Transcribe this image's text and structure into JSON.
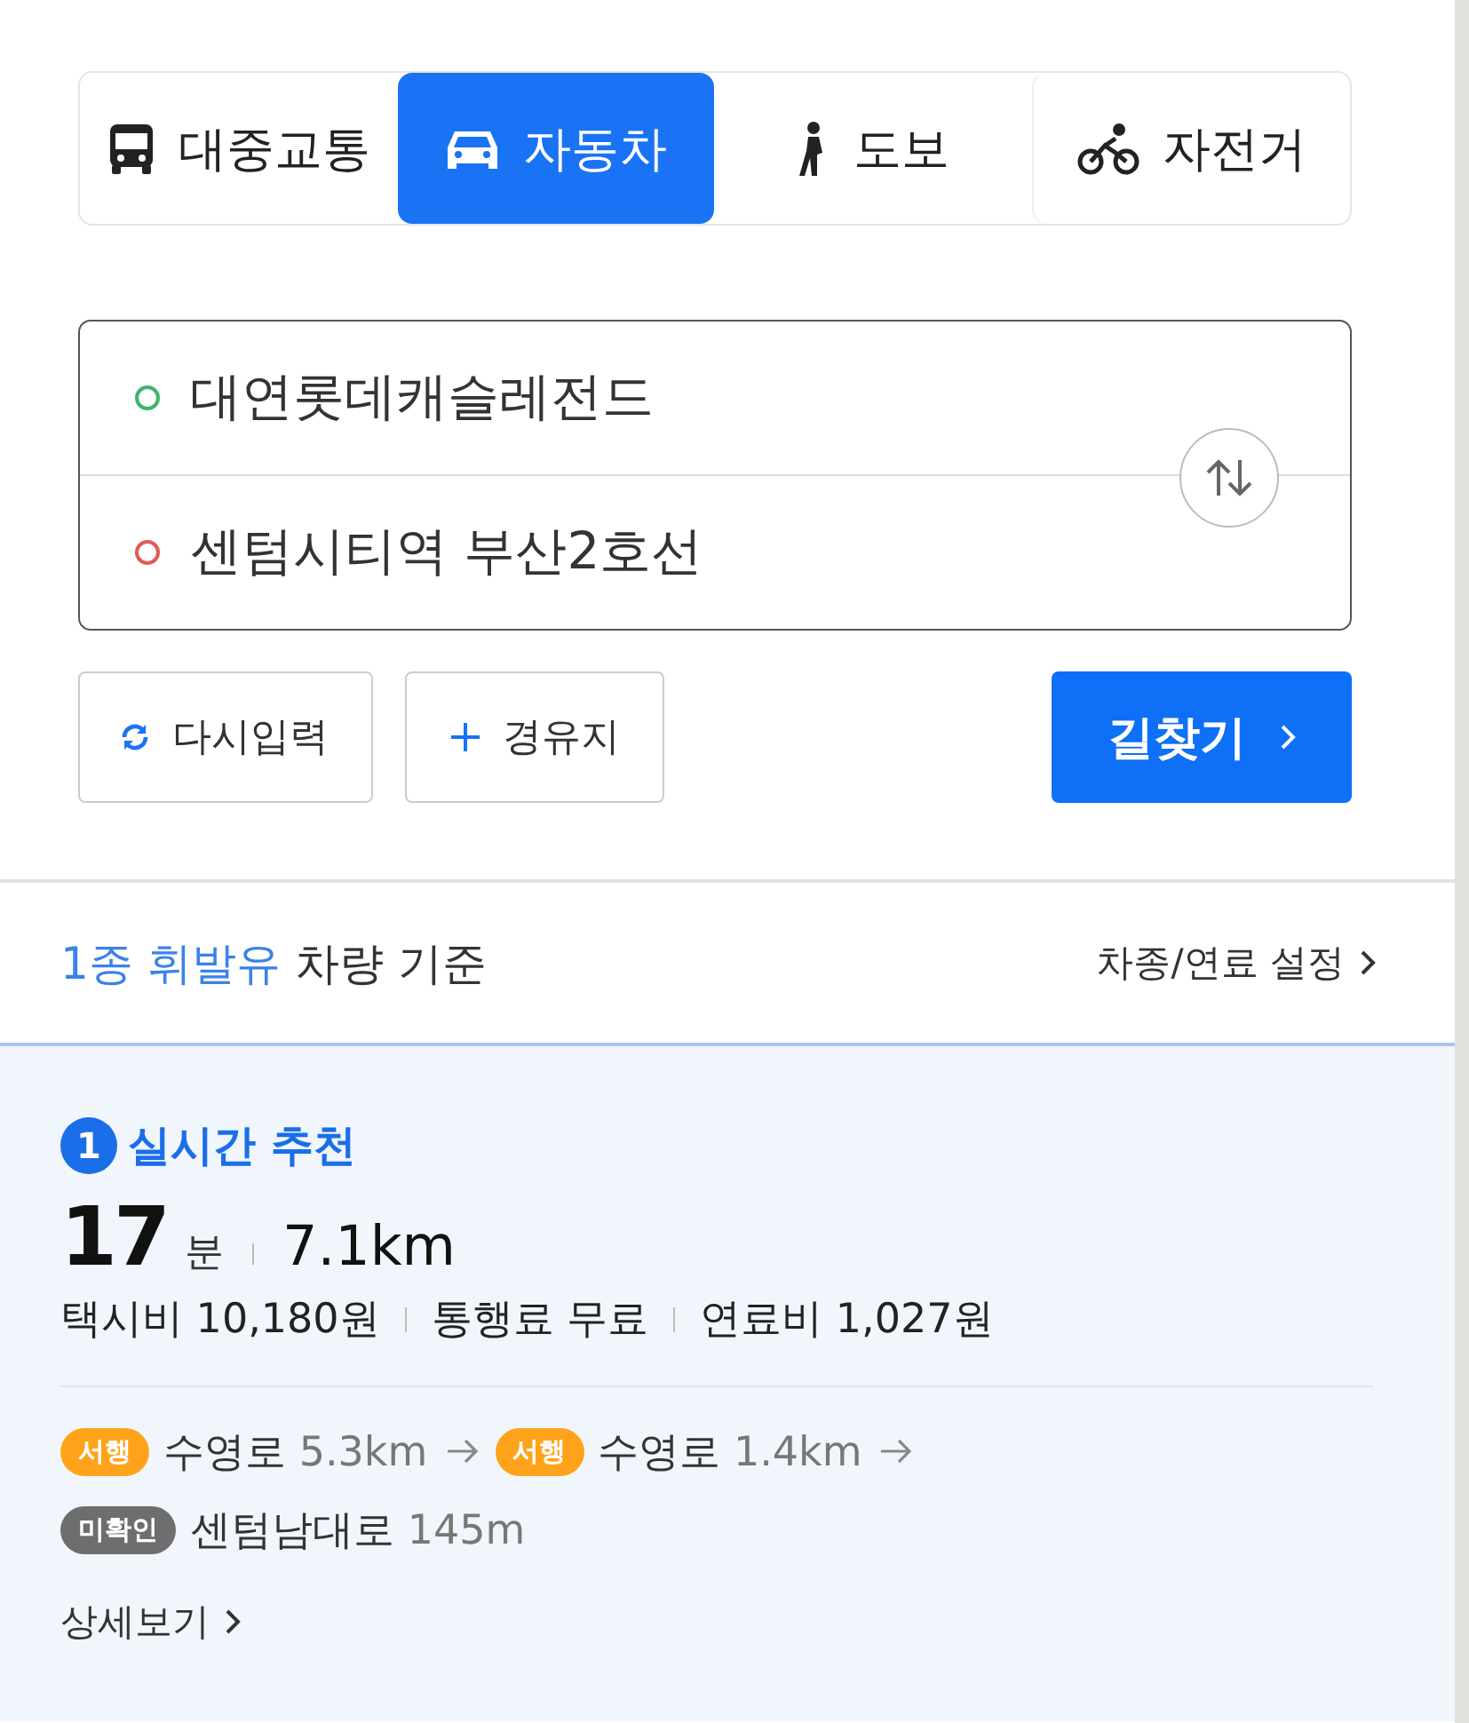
{
  "modes": [
    {
      "kind": "bus",
      "label": "대중교통",
      "selected": false
    },
    {
      "kind": "car",
      "label": "자동차",
      "selected": true
    },
    {
      "kind": "walk",
      "label": "도보",
      "selected": false
    },
    {
      "kind": "bike",
      "label": "자전거",
      "selected": false
    }
  ],
  "route_inputs": [
    {
      "kind": "origin",
      "value": "대연롯데캐슬레전드"
    },
    {
      "kind": "destination",
      "value": "센텀시티역 부산2호선"
    }
  ],
  "actions": [
    {
      "kind": "reset",
      "label": "다시입력"
    },
    {
      "kind": "waypoint",
      "label": "경유지"
    }
  ],
  "search_button": {
    "label": "길찾기"
  },
  "vehicle_basis": {
    "highlight": "1종 휘발유",
    "text": "차량 기준"
  },
  "vehicle_settings_link": {
    "label": "차종/연료 설정"
  },
  "route": {
    "rank": "1",
    "tag": "실시간 추천",
    "minutes": "17",
    "minute_unit": "분",
    "distance": "7.1km",
    "costs": [
      "택시비 10,180원",
      "통행료 무료",
      "연료비 1,027원"
    ],
    "lines": [
      [
        {
          "badge": "서행",
          "color": "#ffa31a",
          "road": "수영로",
          "length": "5.3km",
          "arrow": true
        },
        {
          "badge": "서행",
          "color": "#ffa31a",
          "road": "수영로",
          "length": "1.4km",
          "arrow": true
        }
      ],
      [
        {
          "badge": "미확인",
          "color": "#6e6e6e",
          "road": "센텀남대로",
          "length": "145m",
          "arrow": false
        }
      ]
    ],
    "details_link": "상세보기"
  }
}
